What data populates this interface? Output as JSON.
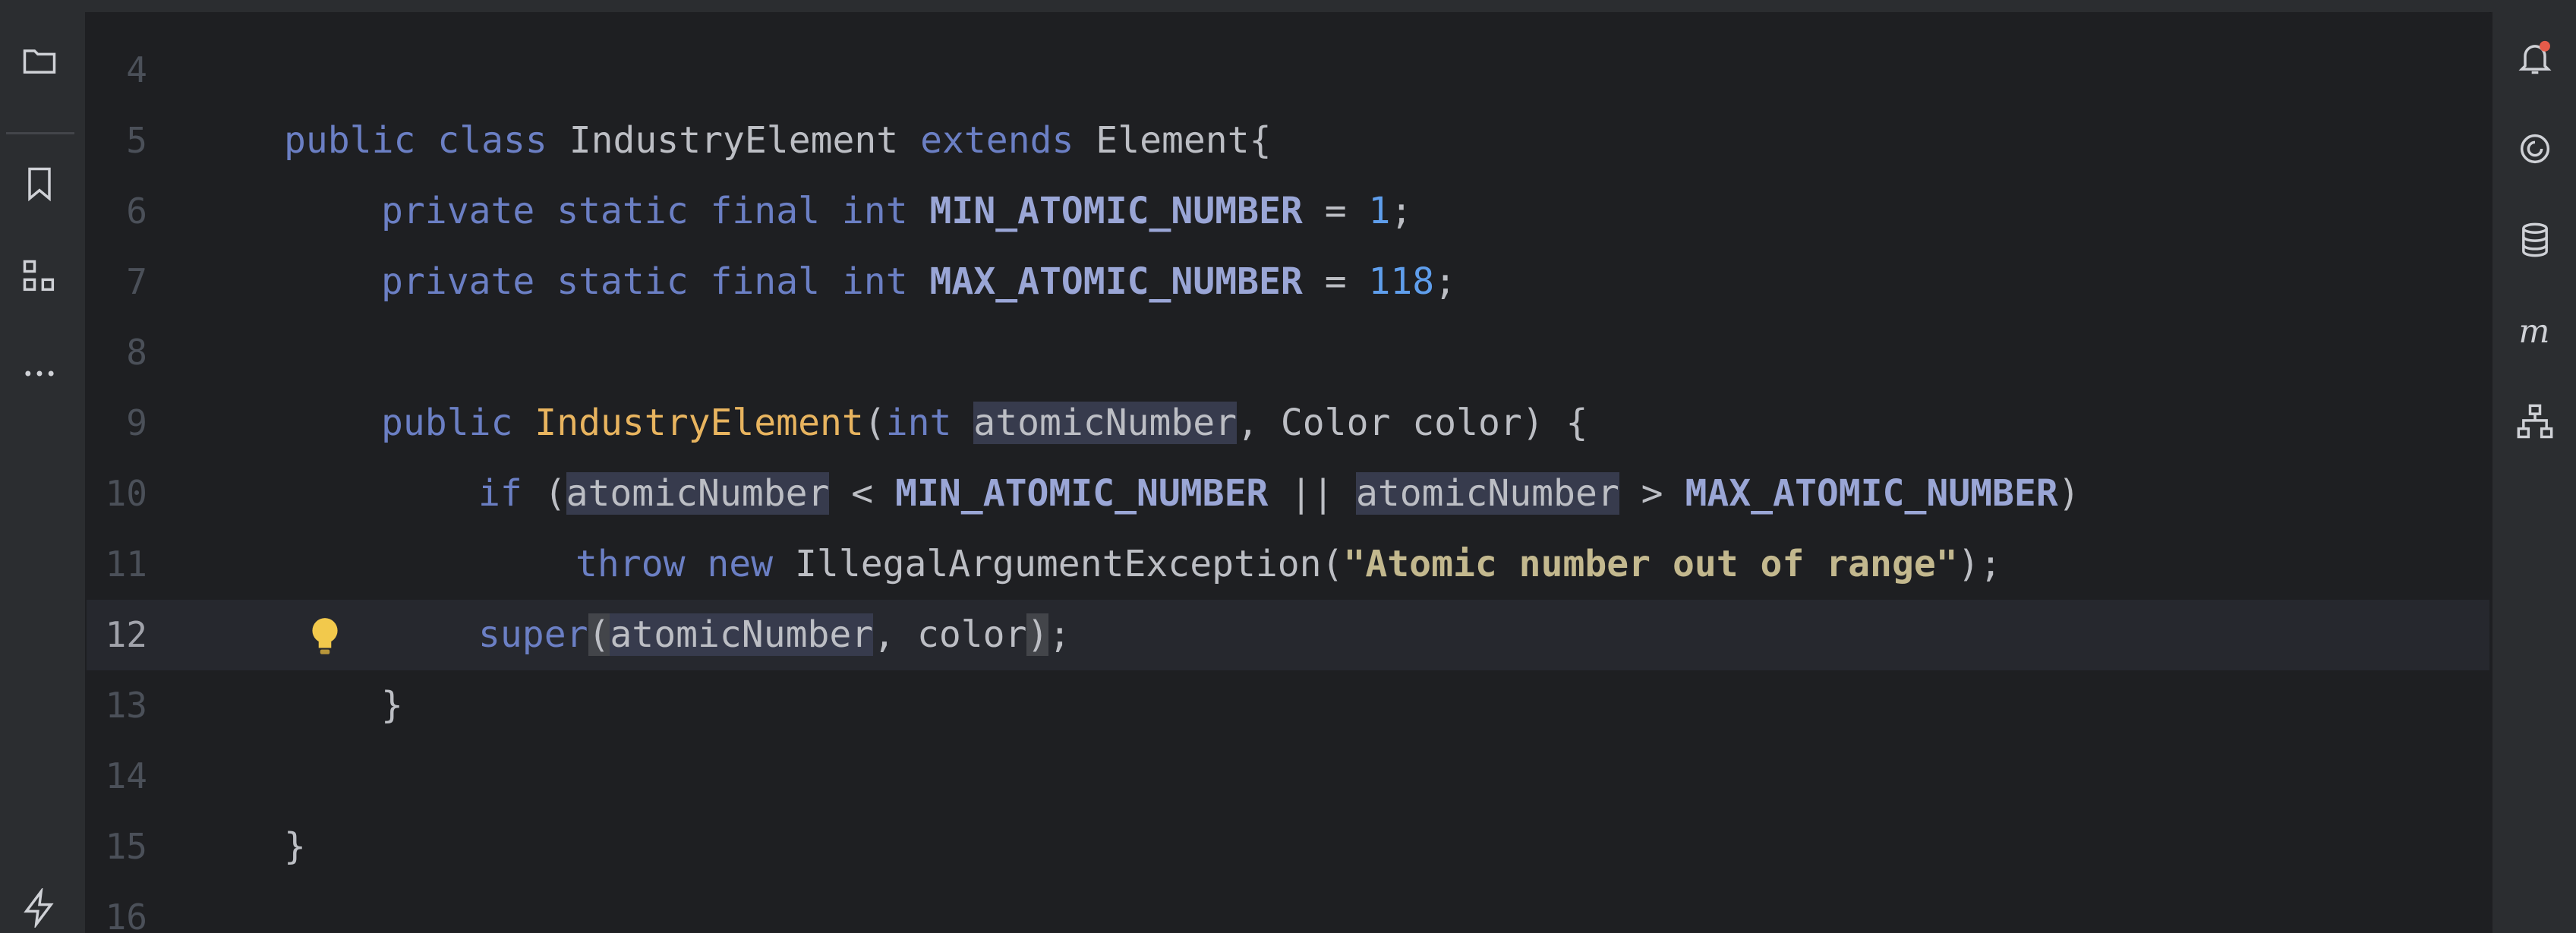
{
  "editor": {
    "current_line": 12,
    "lines": [
      {
        "num": "4"
      },
      {
        "num": "5"
      },
      {
        "num": "6"
      },
      {
        "num": "7"
      },
      {
        "num": "8"
      },
      {
        "num": "9"
      },
      {
        "num": "10"
      },
      {
        "num": "11"
      },
      {
        "num": "12"
      },
      {
        "num": "13"
      },
      {
        "num": "14"
      },
      {
        "num": "15"
      },
      {
        "num": "16"
      }
    ],
    "tokens": {
      "public": "public",
      "class": "class",
      "class_name": "IndustryElement",
      "extends": "extends",
      "parent": "Element{",
      "private": "private",
      "static": "static",
      "final": "final",
      "int": "int",
      "min_const": "MIN_ATOMIC_NUMBER",
      "max_const": "MAX_ATOMIC_NUMBER",
      "eq": " = ",
      "min_val": "1",
      "max_val": "118",
      "semi": ";",
      "ctor_name": "IndustryElement",
      "paren_open": "(",
      "param": "atomicNumber",
      "comma_color": ", Color color) {",
      "if": "if",
      "lt": " < ",
      "or": " || ",
      "gt": " > ",
      "paren_close": ")",
      "throw": "throw",
      "new": "new",
      "exception": "IllegalArgumentException(",
      "message": "\"Atomic number out of range\"",
      "end_call": ");",
      "super": "super",
      "comma_color_arg": ", color",
      "close_brace": "}"
    }
  },
  "icons": {
    "left": [
      "folder-icon",
      "bookmark-icon",
      "structure-icon",
      "more-icon",
      "power-icon"
    ],
    "right": [
      "notification-icon",
      "ai-assistant-icon",
      "database-icon",
      "maven-icon",
      "hierarchy-icon"
    ],
    "status": "check-icon"
  },
  "colors": {
    "keyword": "#6b7fc4",
    "function": "#e8b45f",
    "number": "#5f9eec",
    "constant": "#9aa6d6",
    "string": "#c3b88e",
    "background": "#1e1f22",
    "notification_dot": "#e55b4a"
  }
}
